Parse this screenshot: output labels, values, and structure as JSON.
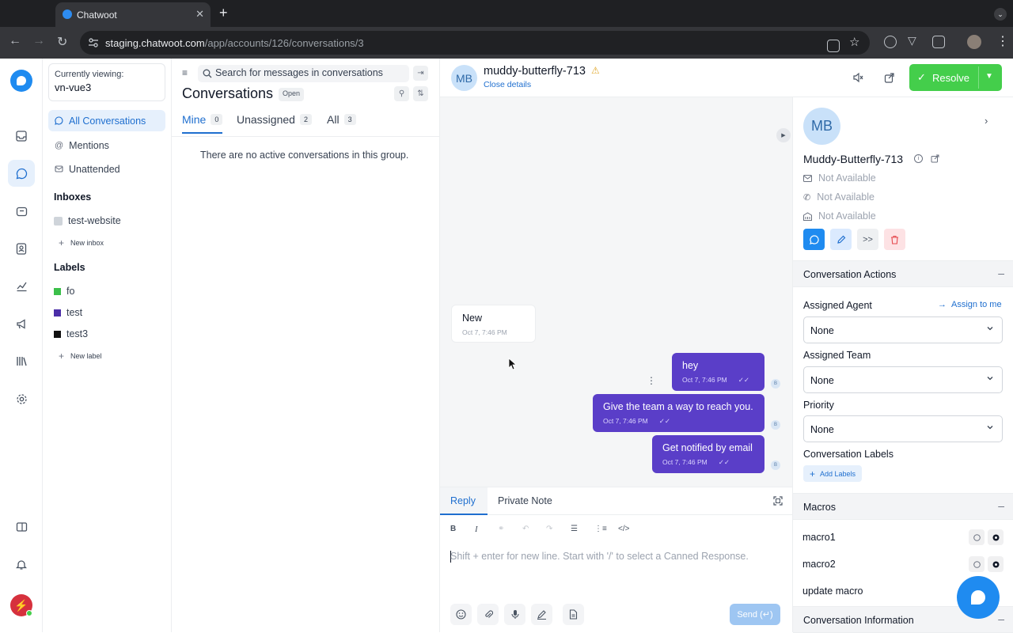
{
  "browser": {
    "tab_title": "Chatwoot",
    "url_host": "staging.chatwoot.com",
    "url_path": "/app/accounts/126/conversations/3"
  },
  "sidebar": {
    "viewing_label": "Currently viewing:",
    "viewing_value": "vn-vue3",
    "nav": [
      "All Conversations",
      "Mentions",
      "Unattended"
    ],
    "inboxes_heading": "Inboxes",
    "inbox": "test-website",
    "new_inbox": "New inbox",
    "labels_heading": "Labels",
    "labels": [
      {
        "name": "fo",
        "color": "#3bbf4a"
      },
      {
        "name": "test",
        "color": "#4b2ea8"
      },
      {
        "name": "test3",
        "color": "#111111"
      }
    ],
    "new_label": "New label"
  },
  "list": {
    "search_placeholder": "Search for messages in conversations",
    "title": "Conversations",
    "status": "Open",
    "tabs": [
      {
        "label": "Mine",
        "count": "0"
      },
      {
        "label": "Unassigned",
        "count": "2"
      },
      {
        "label": "All",
        "count": "3"
      }
    ],
    "empty": "There are no active conversations in this group."
  },
  "conversation": {
    "avatar": "MB",
    "name": "muddy-butterfly-713",
    "close_details": "Close details",
    "resolve": "Resolve",
    "messages": [
      {
        "text": "New",
        "time": "Oct 7, 7:46 PM",
        "type": "incoming"
      },
      {
        "text": "hey",
        "time": "Oct 7, 7:46 PM",
        "type": "outgoing"
      },
      {
        "text": "Give the team a way to reach you.",
        "time": "Oct 7, 7:46 PM",
        "type": "outgoing"
      },
      {
        "text": "Get notified by email",
        "time": "Oct 7, 7:46 PM",
        "type": "outgoing"
      }
    ]
  },
  "reply": {
    "tab_reply": "Reply",
    "tab_note": "Private Note",
    "placeholder": "Shift + enter for new line. Start with '/' to select a Canned Response.",
    "send": "Send (↵)"
  },
  "contact": {
    "avatar": "MB",
    "name": "Muddy-Butterfly-713",
    "email": "Not Available",
    "phone": "Not Available",
    "company": "Not Available",
    "actions_heading": "Conversation Actions",
    "assigned_agent_label": "Assigned Agent",
    "assign_to_me": "Assign to me",
    "assigned_agent": "None",
    "assigned_team_label": "Assigned Team",
    "assigned_team": "None",
    "priority_label": "Priority",
    "priority": "None",
    "labels_label": "Conversation Labels",
    "add_labels": "Add Labels",
    "macros_heading": "Macros",
    "macros": [
      "macro1",
      "macro2",
      "update macro"
    ],
    "info_heading": "Conversation Information"
  },
  "colors": {
    "accent": "#1f6fcf",
    "outgoing_bubble": "#5a3ec8",
    "resolve": "#44ce4b"
  }
}
